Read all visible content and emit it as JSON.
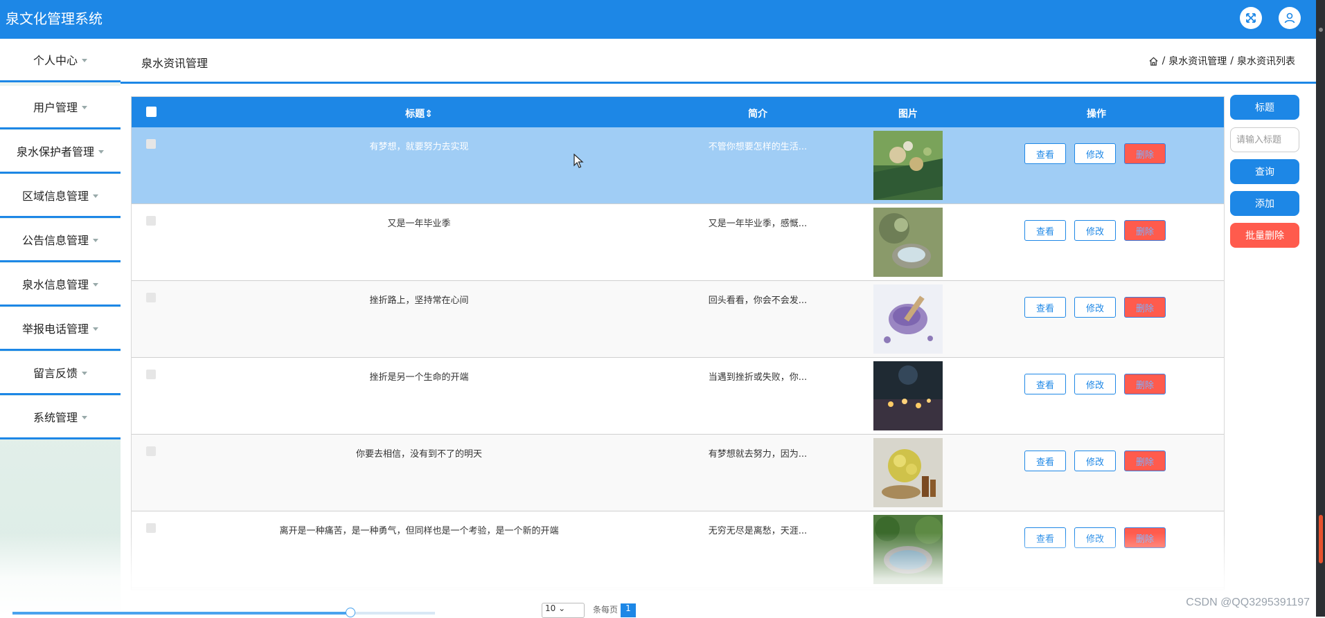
{
  "app": {
    "title": "泉文化管理系统"
  },
  "topbar": {
    "icons": [
      "fullscreen-icon",
      "user-icon"
    ]
  },
  "sidebar": {
    "items": [
      {
        "label": "个人中心"
      },
      {
        "label": "用户管理"
      },
      {
        "label": "泉水保护者管理"
      },
      {
        "label": "区域信息管理"
      },
      {
        "label": "公告信息管理"
      },
      {
        "label": "泉水信息管理"
      },
      {
        "label": "举报电话管理"
      },
      {
        "label": "留言反馈"
      },
      {
        "label": "系统管理"
      }
    ]
  },
  "header": {
    "page_title": "泉水资讯管理",
    "breadcrumb": [
      "泉水资讯管理",
      "泉水资讯列表"
    ]
  },
  "table": {
    "columns": {
      "title": "标题",
      "intro": "简介",
      "image": "图片",
      "actions": "操作"
    },
    "actions": {
      "view": "查看",
      "edit": "修改",
      "delete": "删除"
    },
    "rows": [
      {
        "title": "有梦想，就要努力去实现",
        "intro": "不管你想要怎样的生活...",
        "image": "herbs-on-mat",
        "selected": true
      },
      {
        "title": "又是一年毕业季",
        "intro": "又是一年毕业季，感慨...",
        "image": "stone-bowls-plants",
        "selected": false
      },
      {
        "title": "挫折路上，坚持常在心间",
        "intro": "回头看看，你会不会发...",
        "image": "lavender-bowl",
        "selected": false
      },
      {
        "title": "挫折是另一个生命的开端",
        "intro": "当遇到挫折或失败，你...",
        "image": "candle-table-night",
        "selected": false
      },
      {
        "title": "你要去相信，没有到不了的明天",
        "intro": "有梦想就去努力，因为...",
        "image": "yellow-flowers-bottles",
        "selected": false
      },
      {
        "title": "离开是一种痛苦，是一种勇气，但同样也是一个考验，是一个新的开端",
        "intro": "无穷无尽是离愁，天涯...",
        "image": "garden-pool",
        "selected": false
      }
    ]
  },
  "side_panel": {
    "title_button": "标题",
    "search_placeholder": "请输入标题",
    "query_button": "查询",
    "add_button": "添加",
    "batch_delete_button": "批量删除"
  },
  "pagination": {
    "page_size": "10",
    "per_page_label": "条每页",
    "current_page": "1"
  },
  "scroll_progress": 0.8,
  "watermark": "CSDN @QQ3295391197",
  "colors": {
    "primary": "#1d87e6",
    "danger": "#ff5b4d",
    "selected_row": "#a0cdf5"
  }
}
